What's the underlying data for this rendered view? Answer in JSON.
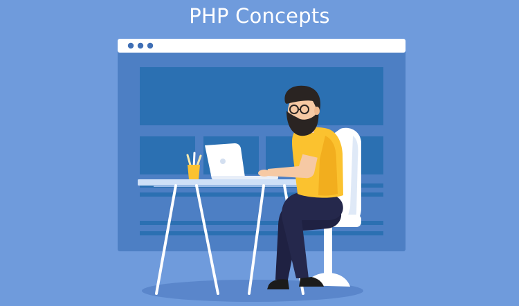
{
  "title": "PHP Concepts",
  "colors": {
    "background": "#6f9bdc",
    "browser_body": "#4d7fc4",
    "browser_bar": "#ffffff",
    "content_block": "#2b70b2",
    "desk": "#a9c9f0",
    "shirt": "#fbc22f",
    "pants": "#222244",
    "chair": "#ffffff"
  }
}
